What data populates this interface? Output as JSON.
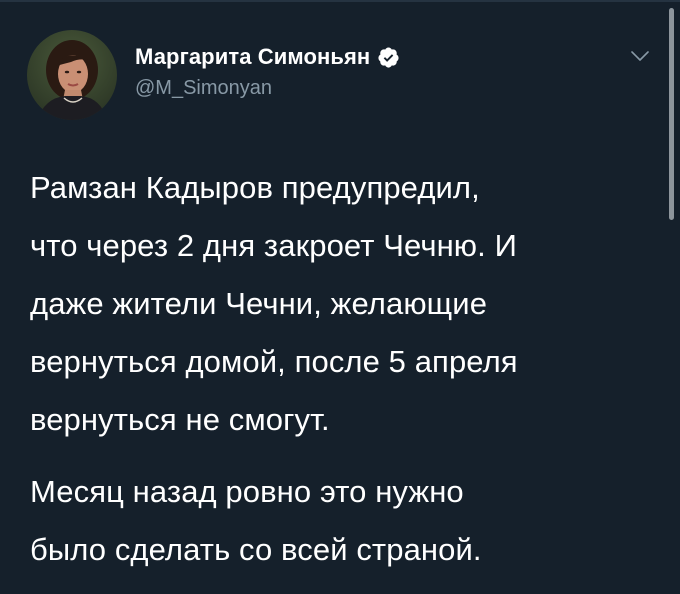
{
  "author": {
    "display_name": "Маргарита Симоньян",
    "handle": "@M_Simonyan",
    "verified": true,
    "avatar_icon": "profile-photo"
  },
  "tweet": {
    "paragraphs": [
      {
        "lines": [
          "Рамзан Кадыров предупредил,",
          "что через 2 дня закроет Чечню. И",
          "даже жители Чечни, желающие",
          "вернуться домой, после 5 апреля",
          "вернуться не смогут."
        ]
      },
      {
        "lines": [
          "Месяц назад ровно это нужно",
          "было сделать со всей страной."
        ]
      }
    ]
  },
  "icons": {
    "verified": "verified-badge-icon",
    "menu": "chevron-down-icon"
  },
  "colors": {
    "background": "#15202b",
    "text": "#ffffff",
    "secondary_text": "#8899a6",
    "verified_badge": "#ffffff"
  }
}
